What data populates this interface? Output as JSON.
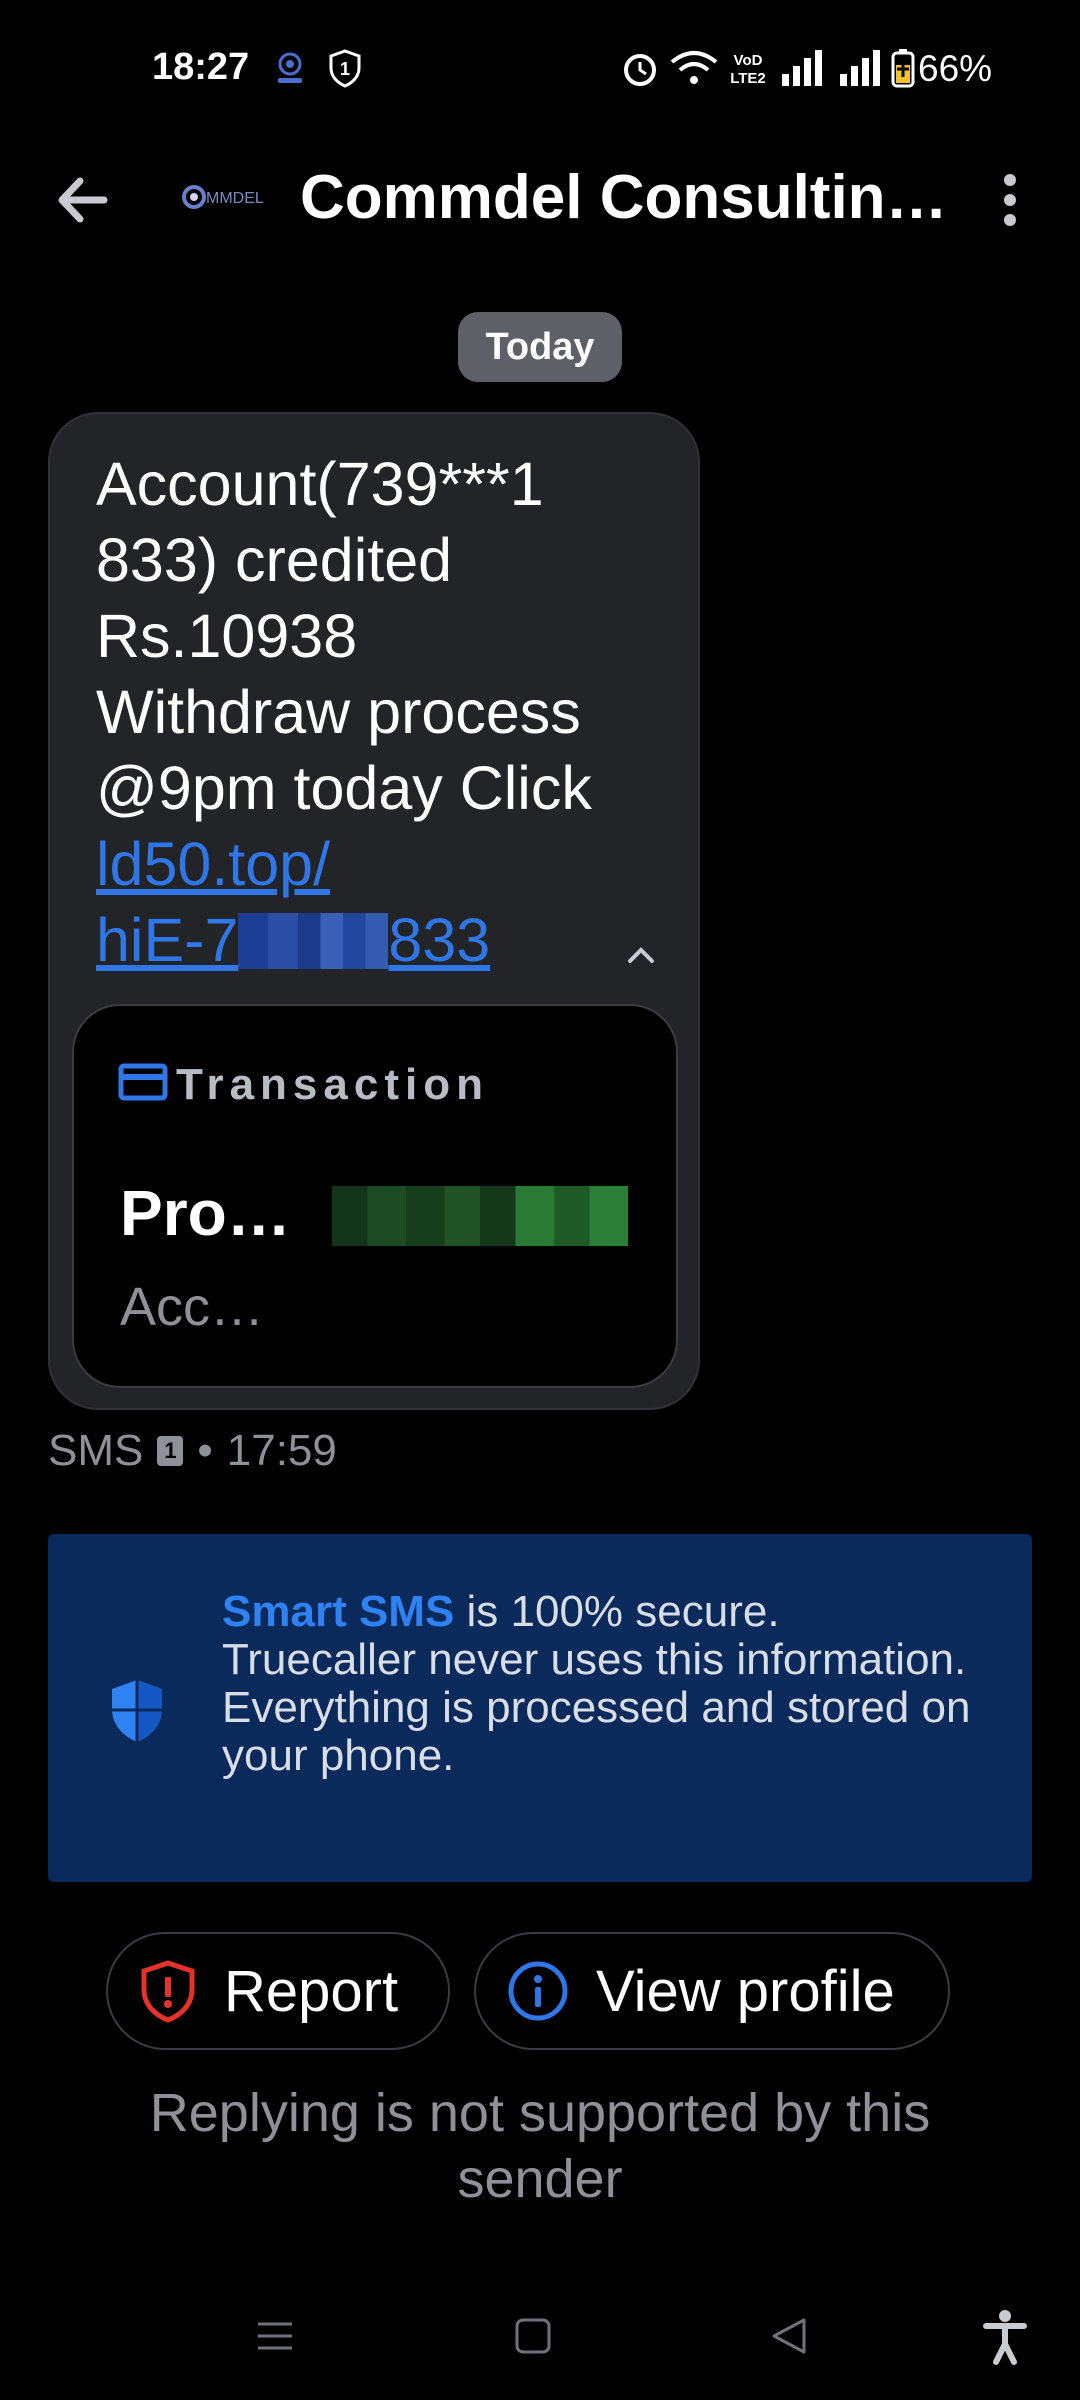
{
  "status_bar": {
    "time": "18:27",
    "battery": "66%",
    "icons": [
      "camera-icon",
      "shield-number-icon",
      "alarm-icon",
      "wifi-icon",
      "volte-icon",
      "signal-icon",
      "signal-icon",
      "battery-icon"
    ]
  },
  "header": {
    "title": "Commdel Consultin…",
    "logo_text": "MMDEL"
  },
  "date_chip": "Today",
  "message": {
    "line1": "Account(739***1",
    "line2": "833) credited",
    "line3": "Rs.10938",
    "line4": "Withdraw process",
    "line5": "@9pm today Click",
    "link_line1": "ld50.top/",
    "link_prefix": "hiE-7",
    "link_suffix": "833",
    "card": {
      "label": "Transaction",
      "title": "Pro…",
      "subtitle": "Acc…"
    },
    "meta_type": "SMS",
    "meta_sim": "1",
    "meta_sep": "•",
    "meta_time": "17:59"
  },
  "banner": {
    "strong": "Smart SMS",
    "text": " is 100% secure. Truecaller never uses this information. Everything is processed and stored on your phone."
  },
  "actions": {
    "report_label": "Report",
    "profile_label": "View profile"
  },
  "reply_note": "Replying is not supported by this sender",
  "colors": {
    "accent_blue": "#2f76e6",
    "banner_bg": "#0b2a5c",
    "report_red": "#e5332a"
  }
}
